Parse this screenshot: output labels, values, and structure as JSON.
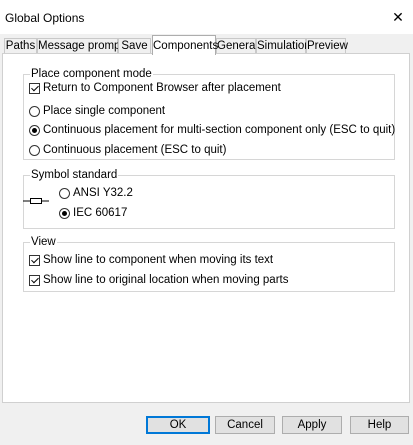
{
  "window": {
    "title": "Global Options",
    "close_glyph": "✕"
  },
  "tabs": [
    {
      "label": "Paths"
    },
    {
      "label": "Message prompts"
    },
    {
      "label": "Save"
    },
    {
      "label": "Components",
      "active": true
    },
    {
      "label": "General"
    },
    {
      "label": "Simulation"
    },
    {
      "label": "Preview"
    }
  ],
  "place_mode": {
    "legend": "Place component mode",
    "return_to_browser": {
      "label": "Return to Component Browser after placement",
      "checked": true
    },
    "options": [
      {
        "label": "Place single component",
        "selected": false
      },
      {
        "label": "Continuous placement for multi-section component only (ESC to quit)",
        "selected": true
      },
      {
        "label": "Continuous placement (ESC to quit)",
        "selected": false
      }
    ]
  },
  "symbol_standard": {
    "legend": "Symbol standard",
    "icon": "resistor-symbol-icon",
    "options": [
      {
        "label": "ANSI Y32.2",
        "selected": false
      },
      {
        "label": "IEC 60617",
        "selected": true
      }
    ]
  },
  "view": {
    "legend": "View",
    "show_line_text": {
      "label": "Show line to component when moving its text",
      "checked": true
    },
    "show_line_parts": {
      "label": "Show line to original location when moving parts",
      "checked": true
    }
  },
  "buttons": {
    "ok": "OK",
    "cancel": "Cancel",
    "apply": "Apply",
    "help": "Help"
  },
  "colors": {
    "panel_bg": "#ffffff",
    "dialog_bg": "#f0f0f0",
    "default_button_border": "#0078d7"
  }
}
